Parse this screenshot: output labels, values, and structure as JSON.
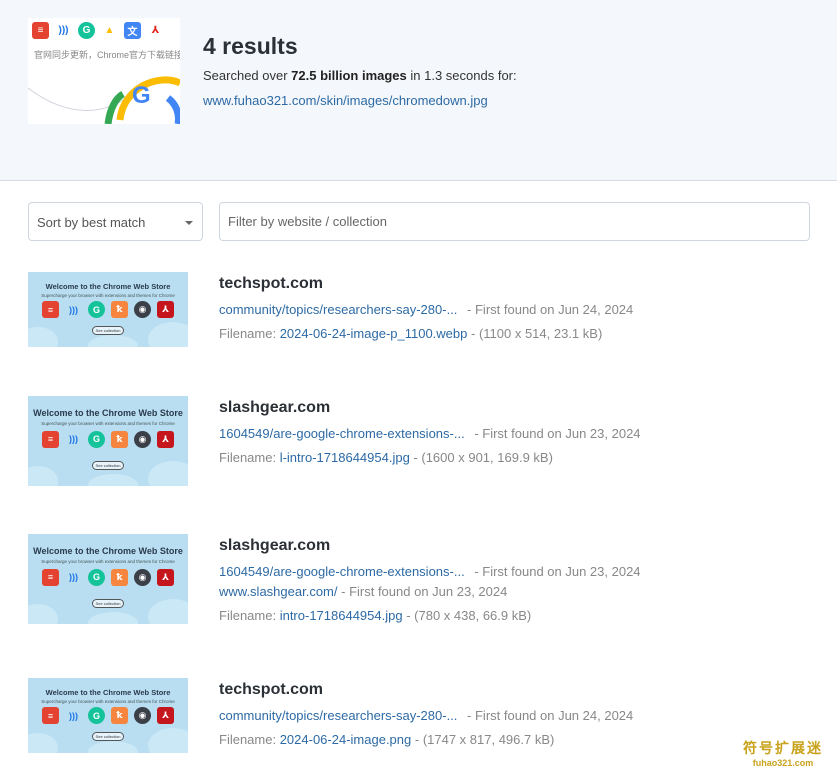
{
  "header": {
    "results_count": "4 results",
    "searched_prefix": "Searched over ",
    "searched_count": "72.5 billion images",
    "searched_suffix": " in 1.3 seconds for:",
    "query_url": "www.fuhao321.com/skin/images/chromedown.jpg",
    "query_thumbnail_caption": "官网同步更新，Chrome官方下载链接"
  },
  "controls": {
    "sort_label": "Sort by best match",
    "filter_placeholder": "Filter by website / collection"
  },
  "thumbnail": {
    "title": "Welcome to the Chrome Web Store",
    "subtitle": "Supercharge your browser with extensions and themes for Chrome",
    "button": "See collection"
  },
  "results": [
    {
      "site": "techspot.com",
      "backlinks": [
        {
          "url": "community/topics/researchers-say-280-...",
          "found": "First found on Jun 24, 2024"
        }
      ],
      "filename": "2024-06-24-image-p_1100.webp",
      "meta": "(1100 x 514, 23.1 kB)"
    },
    {
      "site": "slashgear.com",
      "backlinks": [
        {
          "url": "1604549/are-google-chrome-extensions-...",
          "found": "First found on Jun 23, 2024"
        }
      ],
      "filename": "l-intro-1718644954.jpg",
      "meta": "(1600 x 901, 169.9 kB)"
    },
    {
      "site": "slashgear.com",
      "backlinks": [
        {
          "url": "1604549/are-google-chrome-extensions-...",
          "found": "First found on Jun 23, 2024"
        },
        {
          "url": "www.slashgear.com/",
          "found": "First found on Jun 23, 2024"
        }
      ],
      "filename": "intro-1718644954.jpg",
      "meta": "(780 x 438, 66.9 kB)"
    },
    {
      "site": "techspot.com",
      "backlinks": [
        {
          "url": "community/topics/researchers-say-280-...",
          "found": "First found on Jun 24, 2024"
        }
      ],
      "filename": "2024-06-24-image.png",
      "meta": "(1747 x 817, 496.7 kB)"
    }
  ],
  "labels": {
    "filename_prefix": "Filename: ",
    "separator": " - "
  },
  "watermark": {
    "text": "符号扩展迷",
    "url": "fuhao321.com"
  },
  "colors": {
    "link": "#2d6aa5",
    "header_bg": "#f4f7fb",
    "thumb_bg": "#b9def1"
  }
}
